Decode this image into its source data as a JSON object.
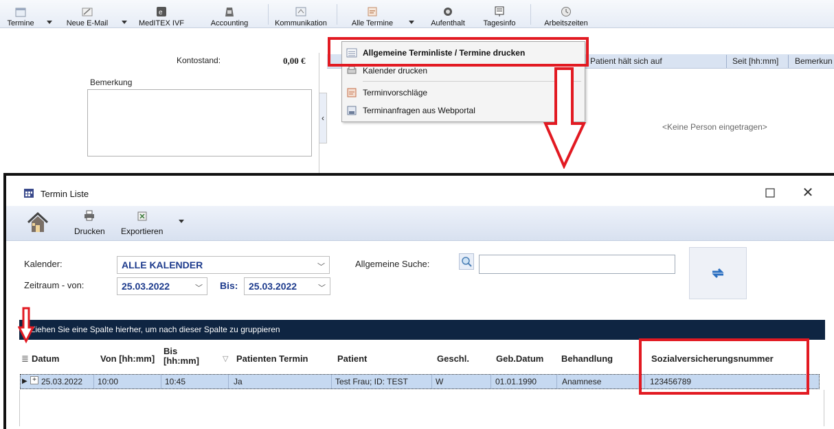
{
  "toolbar": {
    "buttons": [
      {
        "label": "Termine"
      },
      {
        "label": "Neue E-Mail"
      },
      {
        "label": "MedITEX IVF"
      },
      {
        "label": "Accounting"
      },
      {
        "label": "Kommunikation"
      },
      {
        "label": "Alle Termine"
      },
      {
        "label": "Aufenthalt"
      },
      {
        "label": "Tagesinfo"
      },
      {
        "label": "Arbeitszeiten"
      }
    ]
  },
  "account": {
    "label": "Kontostand:",
    "value": "0,00 €"
  },
  "remarks": {
    "label": "Bemerkung"
  },
  "presence_table": {
    "columns": [
      "Patient hält sich auf",
      "Seit [hh:mm]",
      "Bemerkun"
    ],
    "empty_text": "<Keine Person eingetragen>"
  },
  "dropdown_menu": {
    "items": [
      {
        "label": "Allgemeine Terminliste / Termine drucken"
      },
      {
        "label": "Kalender drucken"
      },
      {
        "label": "Terminvorschläge"
      },
      {
        "label": "Terminanfragen aus Webportal"
      }
    ]
  },
  "window": {
    "title": "Termin Liste",
    "close_glyph": "✕",
    "toolbar": {
      "print_label": "Drucken",
      "export_label": "Exportieren"
    },
    "filters": {
      "calendar_label": "Kalender:",
      "calendar_value": "ALLE KALENDER",
      "period_label": "Zeitraum - von:",
      "from_value": "25.03.2022",
      "to_label": "Bis:",
      "to_value": "25.03.2022",
      "search_label": "Allgemeine Suche:",
      "search_value": ""
    },
    "group_panel_text": "Ziehen Sie eine Spalte hierher, um nach dieser Spalte zu gruppieren",
    "grid": {
      "columns": [
        "Datum",
        "Von [hh:mm]",
        "Bis [hh:mm]",
        "Patienten Termin",
        "Patient",
        "Geschl.",
        "Geb.Datum",
        "Behandlung",
        "Sozialversicherungsnummer"
      ],
      "rows": [
        {
          "datum": "25.03.2022",
          "von": "10:00",
          "bis": "10:45",
          "patienten_termin": "Ja",
          "patient": "Test Frau; ID: TEST",
          "geschl": "W",
          "geb_datum": "01.01.1990",
          "behandlung": "Anamnese",
          "svnr": "123456789"
        }
      ]
    }
  },
  "colors": {
    "annotation_red": "#e21a22",
    "group_panel_bg": "#0f2542",
    "selected_row_bg": "#c6d9f1",
    "filter_value_blue": "#1c3a8c"
  }
}
